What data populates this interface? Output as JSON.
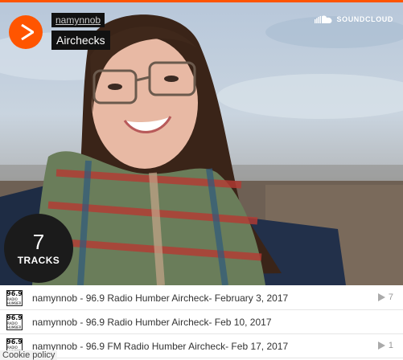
{
  "header": {
    "artist": "namynnob",
    "playlist_title": "Airchecks",
    "brand": "SOUNDCLOUD"
  },
  "icons": {
    "play": "play-icon",
    "logo": "soundcloud-cloud-icon",
    "track_play": "play-triangle-icon"
  },
  "colors": {
    "accent": "#ff5500",
    "label_bg": "#111111",
    "count_bubble": "#1b1b1b"
  },
  "track_count": {
    "number": "7",
    "label": "TRACKS"
  },
  "tracks": [
    {
      "thumb_top": "96.9",
      "thumb_bottom": "RADIO HUMBER",
      "title": "namynnob - 96.9 Radio Humber Aircheck- February 3, 2017",
      "plays": "7"
    },
    {
      "thumb_top": "96.9",
      "thumb_bottom": "RADIO HUMBER",
      "title": "namynnob - 96.9 Radio Humber Aircheck- Feb 10, 2017",
      "plays": ""
    },
    {
      "thumb_top": "96.9",
      "thumb_bottom": "RADIO HUMBER",
      "title": "namynnob - 96.9 FM Radio Humber Aircheck- Feb 17, 2017",
      "plays": "1"
    }
  ],
  "footer": {
    "cookie_policy": "Cookie policy"
  }
}
